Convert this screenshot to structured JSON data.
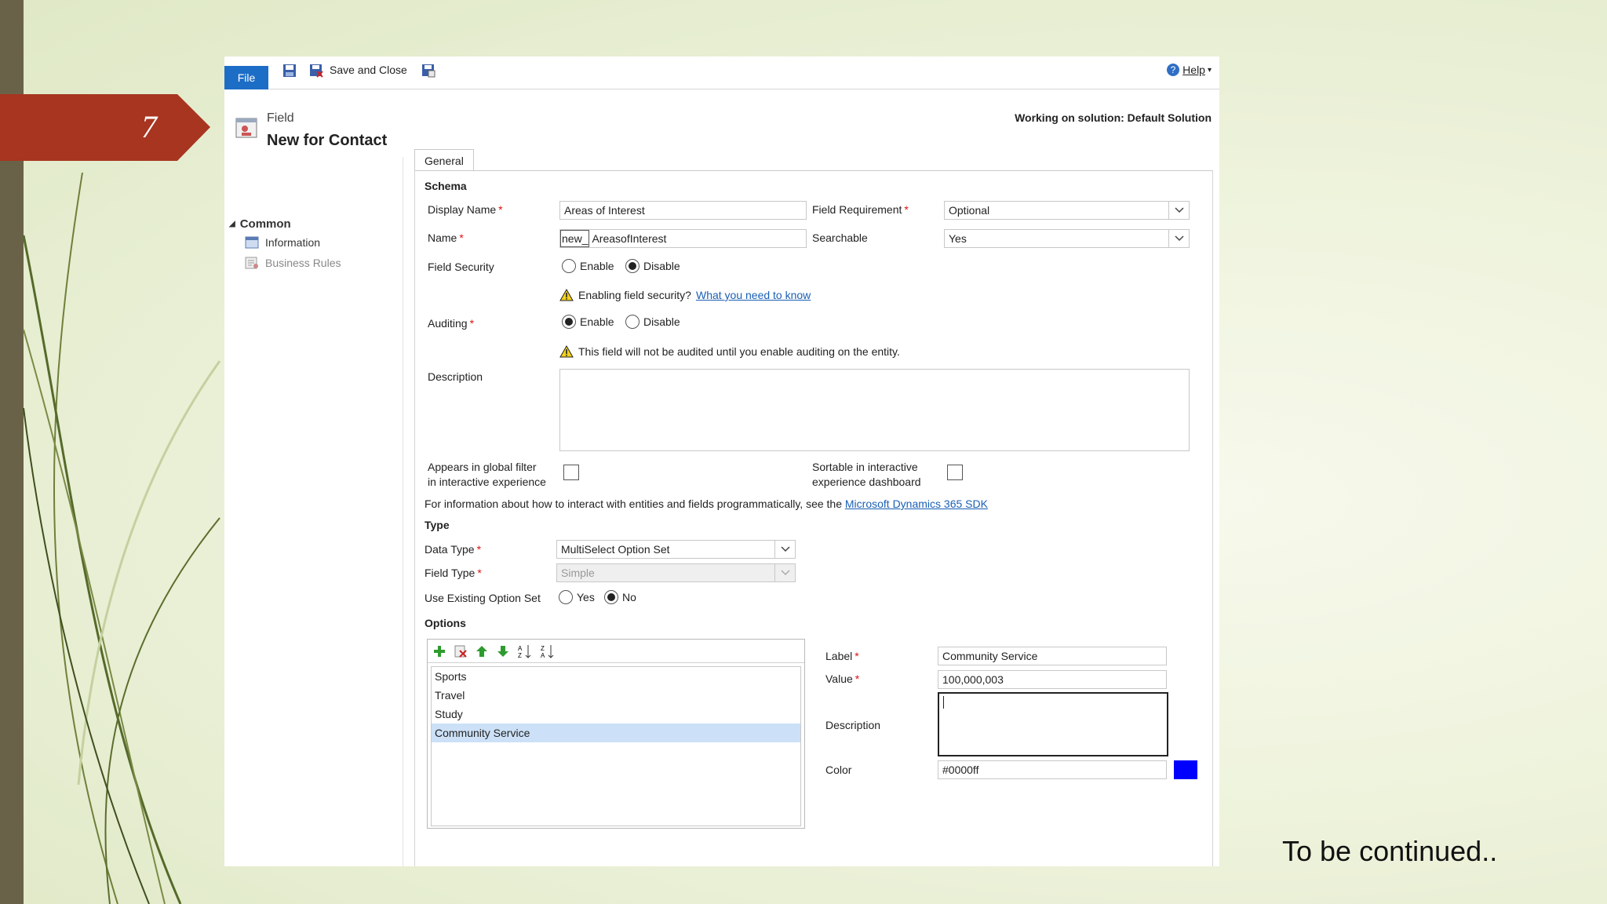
{
  "slide": {
    "number": "7",
    "footer_text": "To be continued.."
  },
  "toolbar": {
    "file_label": "File",
    "save_close_label": "Save and Close",
    "help_label": "Help"
  },
  "header": {
    "entity_kind": "Field",
    "title": "New for Contact",
    "solution_text": "Working on solution: Default Solution"
  },
  "nav": {
    "section": "Common",
    "items": [
      {
        "label": "Information",
        "enabled": true
      },
      {
        "label": "Business Rules",
        "enabled": false
      }
    ]
  },
  "tab": {
    "label": "General"
  },
  "schema": {
    "heading": "Schema",
    "display_name_label": "Display Name",
    "display_name_value": "Areas of Interest",
    "name_label": "Name",
    "name_prefix": "new_",
    "name_value": "AreasofInterest",
    "field_requirement_label": "Field Requirement",
    "field_requirement_value": "Optional",
    "searchable_label": "Searchable",
    "searchable_value": "Yes",
    "field_security_label": "Field Security",
    "enable_label": "Enable",
    "disable_label": "Disable",
    "field_security_selected": "Disable",
    "security_warning": "Enabling field security?",
    "security_link": "What you need to know",
    "auditing_label": "Auditing",
    "auditing_selected": "Enable",
    "auditing_warning": "This field will not be audited until you enable auditing on the entity.",
    "description_label": "Description",
    "global_filter_label_1": "Appears in global filter",
    "global_filter_label_2": "in interactive experience",
    "sortable_label_1": "Sortable in interactive",
    "sortable_label_2": "experience dashboard",
    "sdk_text": "For information about how to interact with entities and fields programmatically, see the",
    "sdk_link": "Microsoft Dynamics 365 SDK"
  },
  "type": {
    "heading": "Type",
    "data_type_label": "Data Type",
    "data_type_value": "MultiSelect Option Set",
    "field_type_label": "Field Type",
    "field_type_value": "Simple",
    "use_existing_label": "Use Existing Option Set",
    "yes_label": "Yes",
    "no_label": "No",
    "use_existing_selected": "No"
  },
  "options": {
    "heading": "Options",
    "items": [
      "Sports",
      "Travel",
      "Study",
      "Community Service"
    ],
    "selected_index": 3,
    "label_label": "Label",
    "label_value": "Community Service",
    "value_label": "Value",
    "value_value": "100,000,003",
    "description_label": "Description",
    "color_label": "Color",
    "color_value": "#0000ff",
    "swatch_color": "#0000ff"
  },
  "colors": {
    "badge": "#a73520",
    "file_button": "#1c6dc6",
    "link": "#1a5fb4",
    "selection": "#cce1f7"
  }
}
